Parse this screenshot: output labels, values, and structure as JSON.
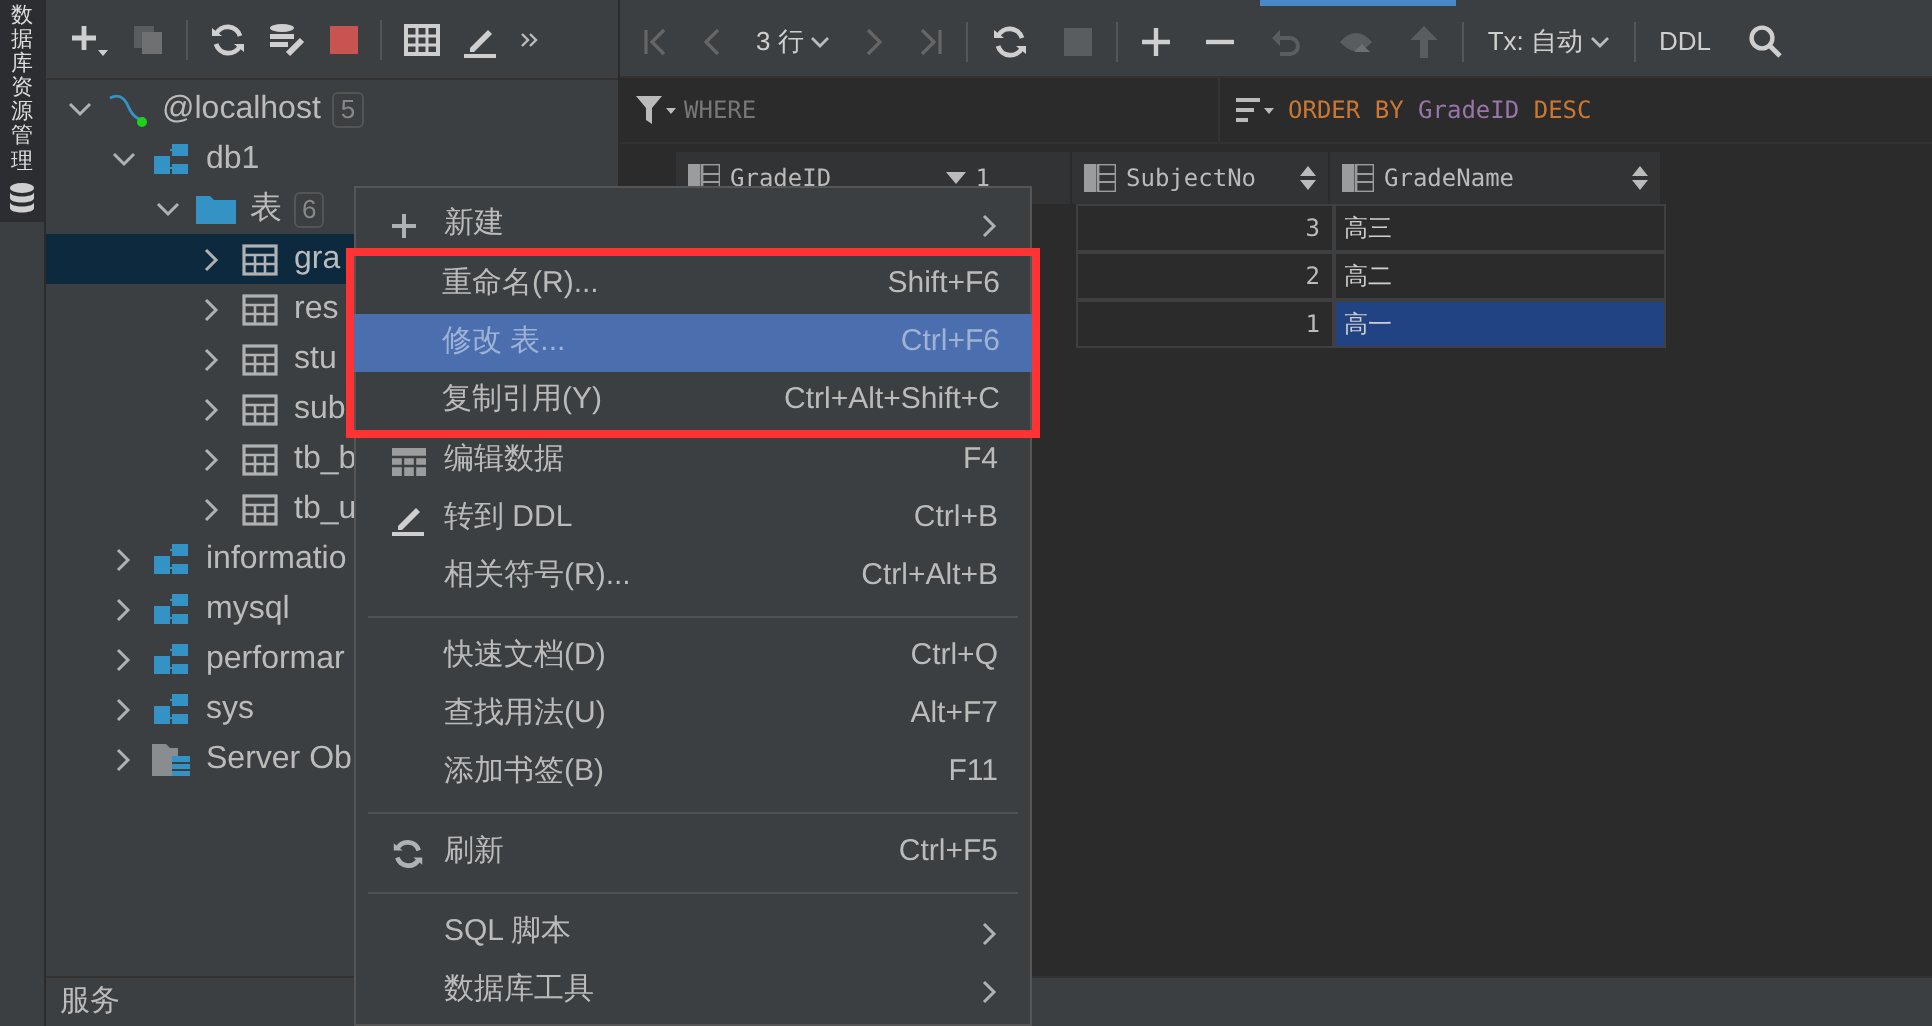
{
  "side_tab": {
    "label": "数据库资源管理"
  },
  "tree": [
    {
      "label": "@localhost",
      "badge": "5",
      "kind": "host",
      "expanded": true,
      "children": [
        {
          "label": "db1",
          "kind": "schema",
          "expanded": true,
          "children": [
            {
              "label": "表",
              "badge": "6",
              "kind": "folder",
              "expanded": true,
              "children": [
                {
                  "label": "gra",
                  "kind": "table",
                  "expanded": false,
                  "selected": true
                },
                {
                  "label": "res",
                  "kind": "table",
                  "expanded": false,
                  "selected": false
                },
                {
                  "label": "stu",
                  "kind": "table",
                  "expanded": false,
                  "selected": false
                },
                {
                  "label": "sub",
                  "kind": "table",
                  "expanded": false,
                  "selected": false
                },
                {
                  "label": "tb_b",
                  "kind": "table",
                  "expanded": false,
                  "selected": false
                },
                {
                  "label": "tb_u",
                  "kind": "table",
                  "expanded": false,
                  "selected": false
                }
              ]
            }
          ]
        },
        {
          "label": "informatio",
          "kind": "schema",
          "expanded": false
        },
        {
          "label": "mysql",
          "kind": "schema",
          "expanded": false
        },
        {
          "label": "performar",
          "kind": "schema",
          "expanded": false
        },
        {
          "label": "sys",
          "kind": "schema",
          "expanded": false
        },
        {
          "label": "Server Ob",
          "kind": "server",
          "expanded": false
        }
      ]
    }
  ],
  "services": {
    "label": "服务"
  },
  "toolbar": {
    "rows": "3 行",
    "tx": "Tx: 自动",
    "ddl": "DDL"
  },
  "filter": {
    "where": "WHERE",
    "order": [
      {
        "text": "ORDER BY",
        "kind": "keyword"
      },
      {
        "text": "GradeID",
        "kind": "identifier"
      },
      {
        "text": "DESC",
        "kind": "keyword"
      }
    ]
  },
  "table": {
    "columns": [
      {
        "name": "GradeID",
        "sort": "1"
      },
      {
        "name": "SubjectNo"
      },
      {
        "name": "GradeName"
      }
    ],
    "rows": [
      {
        "cells": [
          "3",
          "高三"
        ],
        "selected": false
      },
      {
        "cells": [
          "2",
          "高二"
        ],
        "selected": false
      },
      {
        "cells": [
          "1",
          "高一"
        ],
        "selected": true
      }
    ]
  },
  "context_menu": [
    {
      "kind": "item",
      "label": "新建",
      "submenu": true,
      "selected": false
    },
    {
      "kind": "item",
      "label": "重命名(R)...",
      "shortcut": "Shift+F6",
      "selected": false
    },
    {
      "kind": "item",
      "label": "修改 表...",
      "shortcut": "Ctrl+F6",
      "selected": true
    },
    {
      "kind": "item",
      "label": "复制引用(Y)",
      "shortcut": "Ctrl+Alt+Shift+C",
      "selected": false
    },
    {
      "kind": "item",
      "label": "编辑数据",
      "shortcut": "F4",
      "selected": false
    },
    {
      "kind": "item",
      "label": "转到 DDL",
      "shortcut": "Ctrl+B",
      "selected": false
    },
    {
      "kind": "item",
      "label": "相关符号(R)...",
      "shortcut": "Ctrl+Alt+B",
      "selected": false
    },
    {
      "kind": "separator"
    },
    {
      "kind": "item",
      "label": "快速文档(D)",
      "shortcut": "Ctrl+Q",
      "selected": false
    },
    {
      "kind": "item",
      "label": "查找用法(U)",
      "shortcut": "Alt+F7",
      "selected": false
    },
    {
      "kind": "item",
      "label": "添加书签(B)",
      "shortcut": "F11",
      "selected": false
    },
    {
      "kind": "separator"
    },
    {
      "kind": "item",
      "label": "刷新",
      "shortcut": "Ctrl+F5",
      "selected": false
    },
    {
      "kind": "separator"
    },
    {
      "kind": "item",
      "label": "SQL 脚本",
      "submenu": true,
      "selected": false
    },
    {
      "kind": "item",
      "label": "数据库工具",
      "submenu": true,
      "selected": false
    }
  ]
}
